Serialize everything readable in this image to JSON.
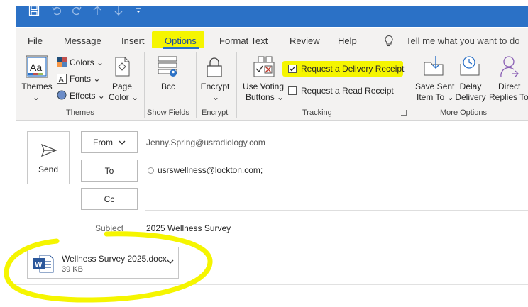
{
  "quick_access": {
    "icons": [
      "save-icon",
      "undo-icon",
      "redo-icon",
      "arrow-up-icon",
      "arrow-down-icon",
      "customize-icon"
    ]
  },
  "menu": {
    "items": [
      "File",
      "Message",
      "Insert",
      "Options",
      "Format Text",
      "Review",
      "Help"
    ],
    "active": "Options",
    "tell_me": "Tell me what you want to do"
  },
  "ribbon": {
    "themes": {
      "themes_label": "Themes",
      "colors_label": "Colors",
      "fonts_label": "Fonts",
      "effects_label": "Effects",
      "page_color_line1": "Page",
      "page_color_line2": "Color",
      "group_label": "Themes"
    },
    "show_fields": {
      "bcc_label": "Bcc",
      "group_label": "Show Fields"
    },
    "encrypt": {
      "encrypt_label": "Encrypt",
      "group_label": "Encrypt"
    },
    "tracking": {
      "voting_line1": "Use Voting",
      "voting_line2": "Buttons",
      "delivery_receipt_label": "Request a Delivery Receipt",
      "delivery_receipt_checked": true,
      "read_receipt_label": "Request a Read Receipt",
      "read_receipt_checked": false,
      "group_label": "Tracking"
    },
    "more_options": {
      "save_sent_line1": "Save Sent",
      "save_sent_line2": "Item To",
      "delay_line1": "Delay",
      "delay_line2": "Delivery",
      "direct_line1": "Direct",
      "direct_line2": "Replies To",
      "group_label": "More Options"
    }
  },
  "compose": {
    "send_label": "Send",
    "from_label": "From",
    "from_value": "Jenny.Spring@usradiology.com",
    "to_label": "To",
    "to_value": "usrswellness@lockton.com",
    "to_separator": ";",
    "cc_label": "Cc",
    "subject_label": "Subject",
    "subject_value": "2025 Wellness Survey"
  },
  "attachment": {
    "name": "Wellness Survey 2025.docx",
    "size": "39 KB",
    "icon": "word-doc-icon"
  },
  "colors": {
    "title_bar": "#2b71c6",
    "highlight": "#f5f500",
    "ribbon_bg": "#f3f2f1",
    "word_blue": "#2b579a"
  }
}
